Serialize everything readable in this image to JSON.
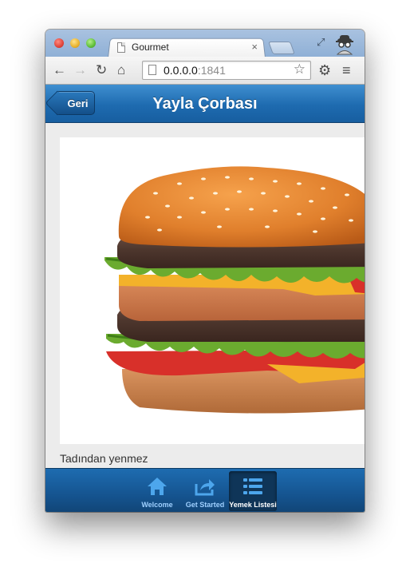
{
  "browser": {
    "tab_title": "Gourmet",
    "tab_close": "×",
    "url_host": "0.0.0.0",
    "url_port": ":1841",
    "icons": {
      "back": "arrow-left-icon",
      "forward": "arrow-right-icon",
      "reload": "reload-icon",
      "home": "home-icon",
      "star": "star-icon",
      "settings": "wrench-icon",
      "menu": "menu-icon",
      "incognito": "incognito-icon"
    }
  },
  "app": {
    "back_label": "Geri",
    "title": "Yayla Çorbası",
    "caption": "Tadından yenmez",
    "accent_color": "#1e6bb0"
  },
  "navbar": {
    "items": [
      {
        "label": "Welcome",
        "icon": "home-icon",
        "active": false
      },
      {
        "label": "Get Started",
        "icon": "share-icon",
        "active": false
      },
      {
        "label": "Yemek Listesi",
        "icon": "list-icon",
        "active": true
      }
    ]
  }
}
